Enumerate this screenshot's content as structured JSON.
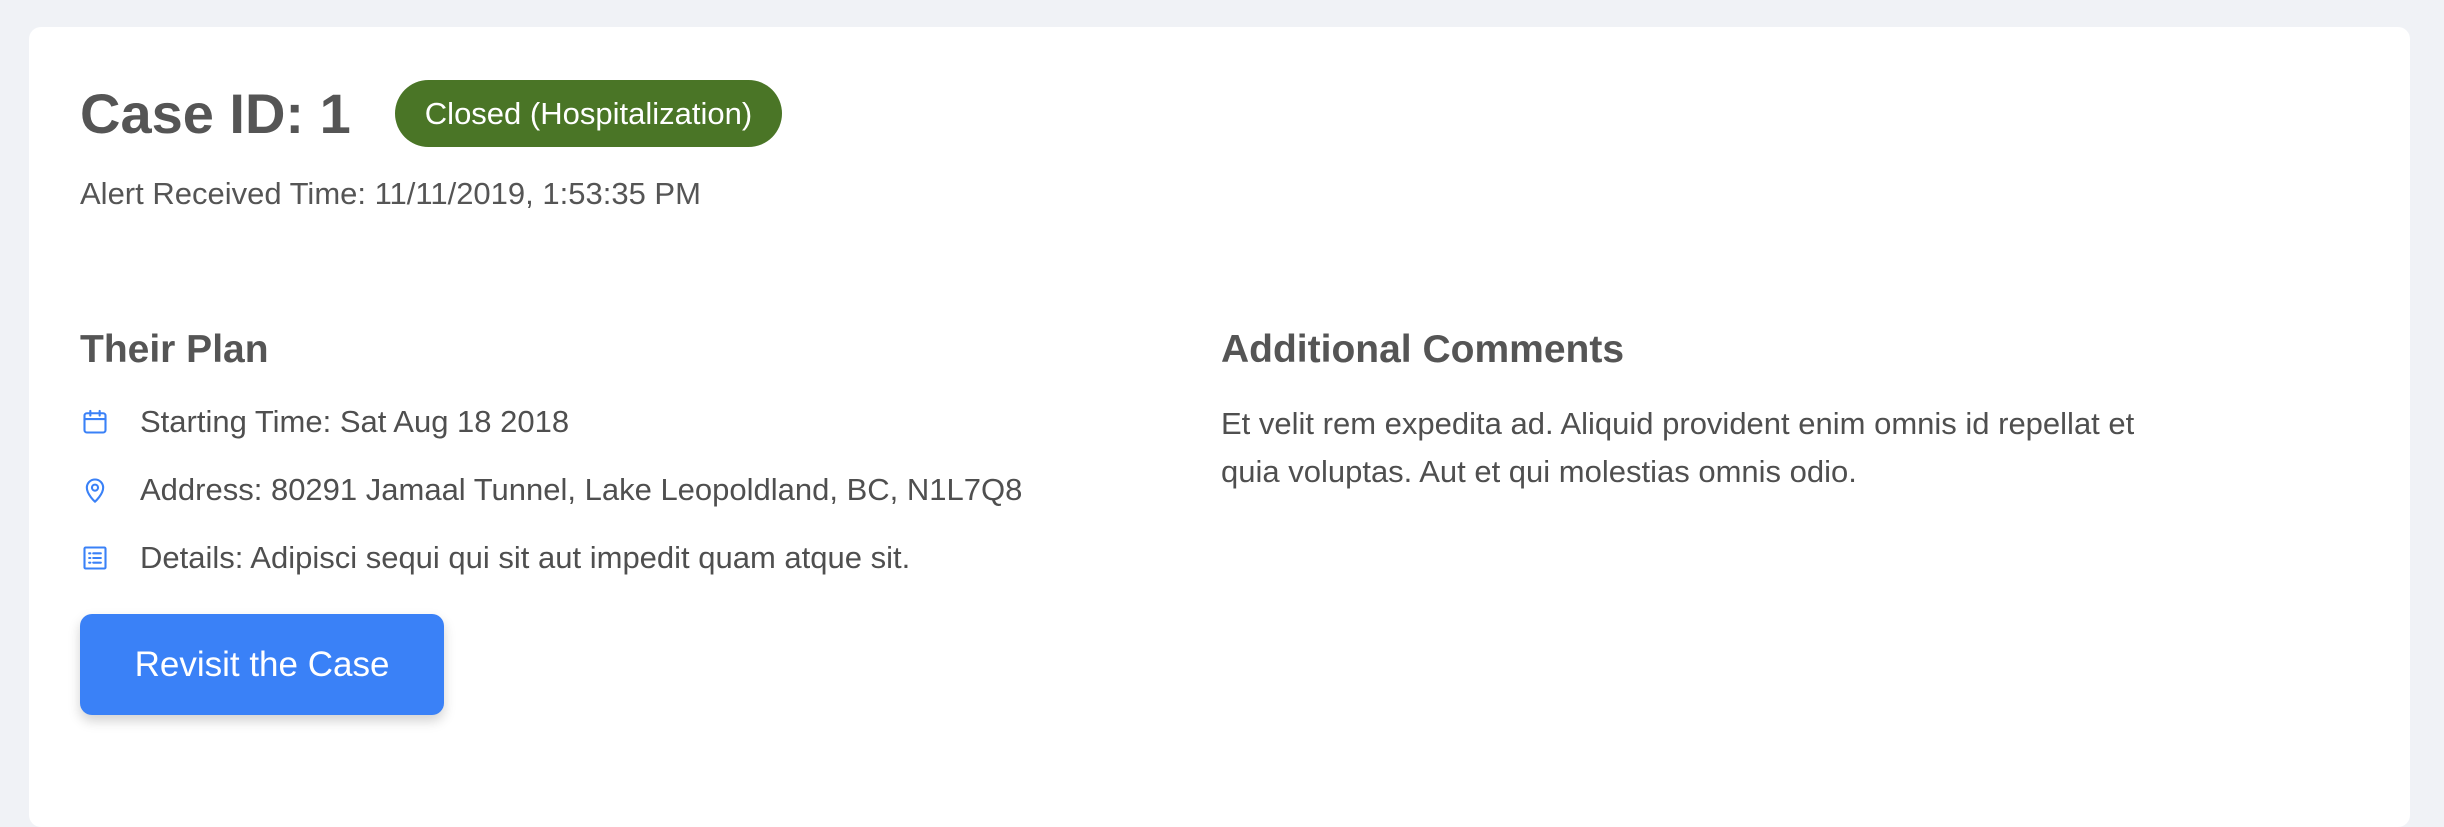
{
  "case": {
    "title": "Case ID: 1",
    "status_label": "Closed (Hospitalization)",
    "alert_time": "Alert Received Time: 11/11/2019, 1:53:35 PM"
  },
  "plan": {
    "title": "Their Plan",
    "items": [
      {
        "icon": "calendar-icon",
        "text": "Starting Time: Sat Aug 18 2018"
      },
      {
        "icon": "location-pin-icon",
        "text": "Address: 80291 Jamaal Tunnel, Lake Leopoldland, BC, N1L7Q8"
      },
      {
        "icon": "list-icon",
        "text": "Details: Adipisci sequi qui sit aut impedit quam atque sit."
      }
    ]
  },
  "comments": {
    "title": "Additional Comments",
    "text": "Et velit rem expedita ad. Aliquid provident enim omnis id repellat et quia voluptas. Aut et qui molestias omnis odio."
  },
  "actions": {
    "revisit_label": "Revisit the Case"
  },
  "colors": {
    "status_badge": "#4a7526",
    "accent": "#3a81f7",
    "background": "#f0f2f6"
  }
}
